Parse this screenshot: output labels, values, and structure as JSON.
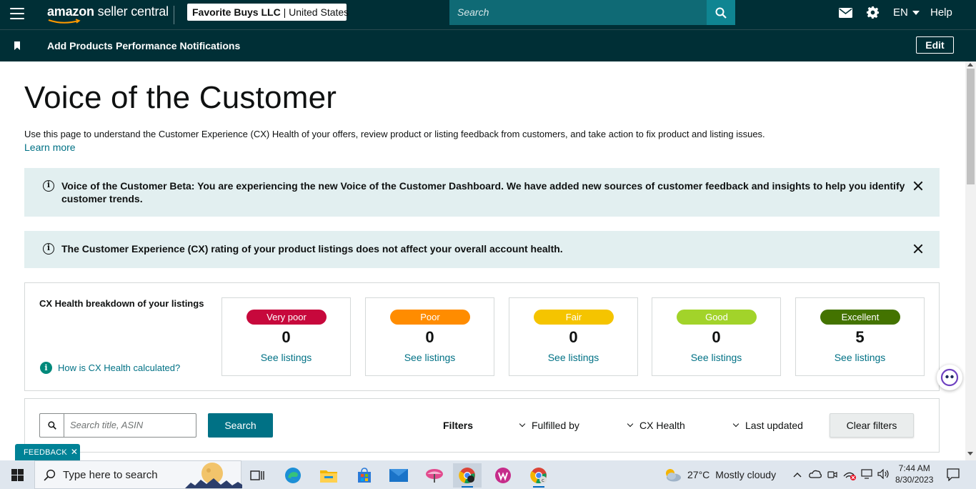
{
  "header": {
    "logo_brand": "amazon",
    "logo_product": "seller central",
    "account_name": "Favorite Buys LLC",
    "account_region": "United States",
    "search_placeholder": "Search",
    "language": "EN",
    "help_label": "Help"
  },
  "nav": {
    "links": [
      "Add Products",
      "Performance Notifications"
    ],
    "edit_label": "Edit"
  },
  "page": {
    "title": "Voice of the Customer",
    "description": "Use this page to understand the Customer Experience (CX) Health of your offers, review product or listing feedback from customers, and take action to fix product and listing issues.",
    "learn_more": "Learn more"
  },
  "alerts": [
    {
      "line1": "Voice of the Customer Beta: You are experiencing the new Voice of the Customer Dashboard. We have added new sources of customer feedback and insights to help you identify",
      "line2": "customer trends."
    },
    {
      "line1": "The Customer Experience (CX) rating of your product listings does not affect your overall account health."
    }
  ],
  "cx_health": {
    "title": "CX Health breakdown of your listings",
    "help_link": "How is CX Health calculated?",
    "link_label": "See listings",
    "categories": [
      {
        "label": "Very poor",
        "count": "0",
        "color": "#c7083c",
        "text_color": "#ffffff"
      },
      {
        "label": "Poor",
        "count": "0",
        "color": "#ff8c00",
        "text_color": "#ffffff"
      },
      {
        "label": "Fair",
        "count": "0",
        "color": "#f5c400",
        "text_color": "#ffffff"
      },
      {
        "label": "Good",
        "count": "0",
        "color": "#a2d32a",
        "text_color": "#ffffff"
      },
      {
        "label": "Excellent",
        "count": "5",
        "color": "#437300",
        "text_color": "#ffffff"
      }
    ]
  },
  "filters": {
    "search_placeholder": "Search title, ASIN",
    "search_button": "Search",
    "label": "Filters",
    "dropdowns": [
      "Fulfilled by",
      "CX Health",
      "Last updated"
    ],
    "clear_button": "Clear filters"
  },
  "feedback_tab": "FEEDBACK",
  "taskbar": {
    "search_text": "Type here to search",
    "weather_temp": "27°C",
    "weather_desc": "Mostly cloudy",
    "time": "7:44 AM",
    "date": "8/30/2023"
  }
}
